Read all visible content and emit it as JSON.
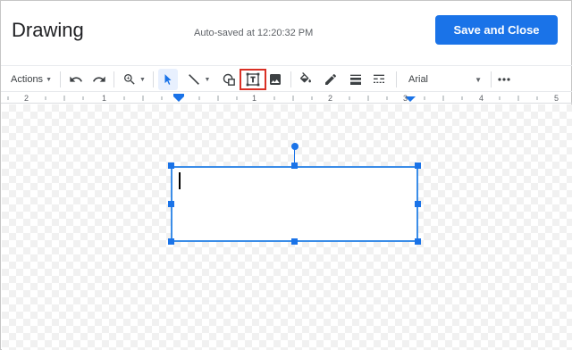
{
  "header": {
    "title": "Drawing",
    "autosave": "Auto-saved at 12:20:32 PM",
    "save_close_label": "Save and Close"
  },
  "toolbar": {
    "actions_label": "Actions",
    "font_name": "Arial",
    "more_label": "⋮",
    "icons": [
      "undo-icon",
      "redo-icon",
      "zoom-icon",
      "select-icon",
      "line-icon",
      "shape-icon",
      "text-box-icon",
      "image-icon",
      "fill-color-icon",
      "border-color-icon",
      "border-weight-icon",
      "border-dash-icon",
      "more-options-icon"
    ],
    "accent": "#1a73e8",
    "highlight_color": "#d93025"
  },
  "ruler": {
    "numbers": [
      "2",
      "1",
      "1",
      "2",
      "3",
      "4",
      "5"
    ]
  }
}
